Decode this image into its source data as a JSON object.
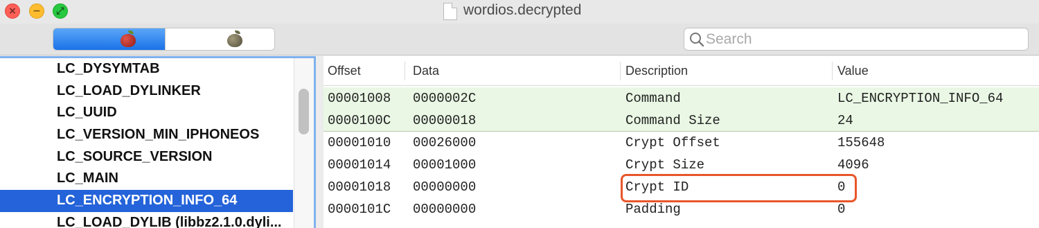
{
  "window": {
    "title": "wordios.decrypted",
    "controls": [
      "×",
      "−",
      "⤢"
    ]
  },
  "toolbar": {
    "segments": [
      {
        "name": "red-apple",
        "selected": true
      },
      {
        "name": "gray-apple",
        "selected": false
      }
    ],
    "search": {
      "placeholder": "Search",
      "value": ""
    }
  },
  "sidebar": {
    "items": [
      {
        "label": "LC_DYSYMTAB"
      },
      {
        "label": "LC_LOAD_DYLINKER"
      },
      {
        "label": "LC_UUID"
      },
      {
        "label": "LC_VERSION_MIN_IPHONEOS"
      },
      {
        "label": "LC_SOURCE_VERSION"
      },
      {
        "label": "LC_MAIN"
      },
      {
        "label": "LC_ENCRYPTION_INFO_64"
      },
      {
        "label": "LC_LOAD_DYLIB (libbz2.1.0.dyli..."
      }
    ],
    "selected_index": 6
  },
  "table": {
    "columns": {
      "offset": "Offset",
      "data": "Data",
      "description": "Description",
      "value": "Value"
    },
    "rows": [
      {
        "offset": "00001008",
        "data": "0000002C",
        "description": "Command",
        "value": "LC_ENCRYPTION_INFO_64"
      },
      {
        "offset": "0000100C",
        "data": "00000018",
        "description": "Command Size",
        "value": "24"
      },
      {
        "offset": "00001010",
        "data": "00026000",
        "description": "Crypt Offset",
        "value": "155648"
      },
      {
        "offset": "00001014",
        "data": "00001000",
        "description": "Crypt Size",
        "value": "4096"
      },
      {
        "offset": "00001018",
        "data": "00000000",
        "description": "Crypt ID",
        "value": "0"
      },
      {
        "offset": "0000101C",
        "data": "00000000",
        "description": "Padding",
        "value": "0"
      }
    ],
    "highlighted_row_index": 4
  },
  "colors": {
    "selection": "#2463d9",
    "header_rows": "#e9f7e4",
    "highlight_box": "#e8562a"
  }
}
